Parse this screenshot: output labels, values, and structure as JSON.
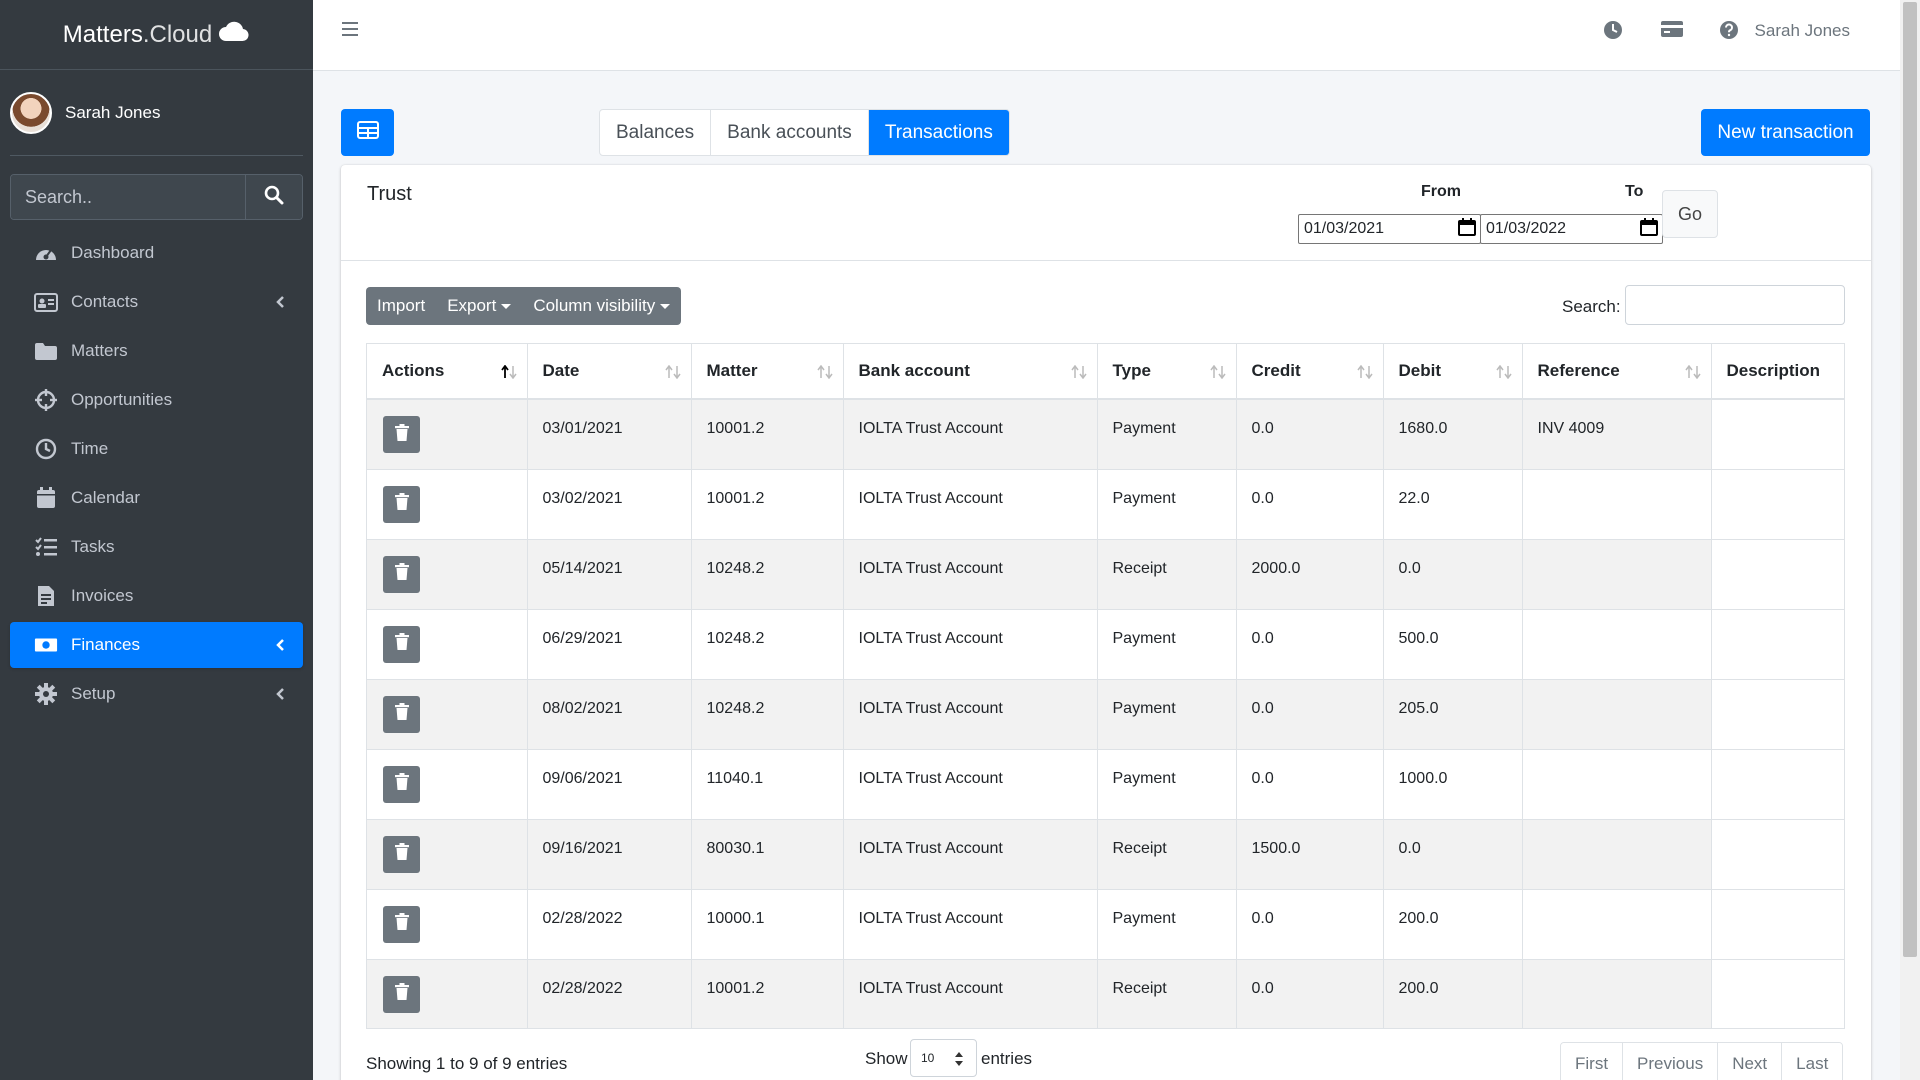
{
  "sidebar": {
    "brand_main": "Matters",
    "brand_light": ".Cloud",
    "user_name": "Sarah Jones",
    "search_placeholder": "Search..",
    "items": [
      {
        "label": "Dashboard",
        "icon": "dashboard-gauge-icon",
        "chevron": false,
        "active": false
      },
      {
        "label": "Contacts",
        "icon": "address-card-icon",
        "chevron": true,
        "active": false
      },
      {
        "label": "Matters",
        "icon": "folder-icon",
        "chevron": false,
        "active": false
      },
      {
        "label": "Opportunities",
        "icon": "crosshairs-icon",
        "chevron": false,
        "active": false
      },
      {
        "label": "Time",
        "icon": "clock-icon",
        "chevron": false,
        "active": false
      },
      {
        "label": "Calendar",
        "icon": "calendar-icon",
        "chevron": false,
        "active": false
      },
      {
        "label": "Tasks",
        "icon": "tasks-list-icon",
        "chevron": false,
        "active": false
      },
      {
        "label": "Invoices",
        "icon": "invoice-file-icon",
        "chevron": false,
        "active": false
      },
      {
        "label": "Finances",
        "icon": "money-bill-icon",
        "chevron": true,
        "active": true
      },
      {
        "label": "Setup",
        "icon": "gear-icon",
        "chevron": true,
        "active": false
      }
    ]
  },
  "header": {
    "user_name": "Sarah Jones",
    "icons": [
      "clock-icon",
      "credit-card-icon",
      "help-icon"
    ]
  },
  "tabs": [
    {
      "label": "Balances",
      "active": false
    },
    {
      "label": "Bank accounts",
      "active": false
    },
    {
      "label": "Transactions",
      "active": true
    }
  ],
  "new_button_label": "New transaction",
  "card": {
    "title": "Trust",
    "from_label": "From",
    "to_label": "To",
    "from_value": "01/03/2021",
    "to_value": "01/03/2022",
    "go_label": "Go"
  },
  "toolbar": {
    "import_label": "Import",
    "export_label": "Export",
    "colvis_label": "Column visibility",
    "search_label": "Search:",
    "search_value": ""
  },
  "table": {
    "columns": [
      "Actions",
      "Date",
      "Matter",
      "Bank account",
      "Type",
      "Credit",
      "Debit",
      "Reference",
      "Description"
    ],
    "rows": [
      [
        "03/01/2021",
        "10001.2",
        "IOLTA Trust Account",
        "Payment",
        "0.0",
        "1680.0",
        "INV 4009",
        ""
      ],
      [
        "03/02/2021",
        "10001.2",
        "IOLTA Trust Account",
        "Payment",
        "0.0",
        "22.0",
        "",
        ""
      ],
      [
        "05/14/2021",
        "10248.2",
        "IOLTA Trust Account",
        "Receipt",
        "2000.0",
        "0.0",
        "",
        ""
      ],
      [
        "06/29/2021",
        "10248.2",
        "IOLTA Trust Account",
        "Payment",
        "0.0",
        "500.0",
        "",
        ""
      ],
      [
        "08/02/2021",
        "10248.2",
        "IOLTA Trust Account",
        "Payment",
        "0.0",
        "205.0",
        "",
        ""
      ],
      [
        "09/06/2021",
        "11040.1",
        "IOLTA Trust Account",
        "Payment",
        "0.0",
        "1000.0",
        "",
        ""
      ],
      [
        "09/16/2021",
        "80030.1",
        "IOLTA Trust Account",
        "Receipt",
        "1500.0",
        "0.0",
        "",
        ""
      ],
      [
        "02/28/2022",
        "10000.1",
        "IOLTA Trust Account",
        "Payment",
        "0.0",
        "200.0",
        "",
        ""
      ],
      [
        "02/28/2022",
        "10001.2",
        "IOLTA Trust Account",
        "Receipt",
        "0.0",
        "200.0",
        "",
        ""
      ]
    ]
  },
  "footer": {
    "info": "Showing 1 to 9 of 9 entries",
    "show_label": "Show",
    "page_size": "10",
    "entries_label": "entries",
    "pages": [
      "First",
      "Previous",
      "Next",
      "Last"
    ]
  },
  "colors": {
    "accent": "#007bff",
    "sidebar_bg": "#343a40",
    "secondary": "#6c757d"
  }
}
